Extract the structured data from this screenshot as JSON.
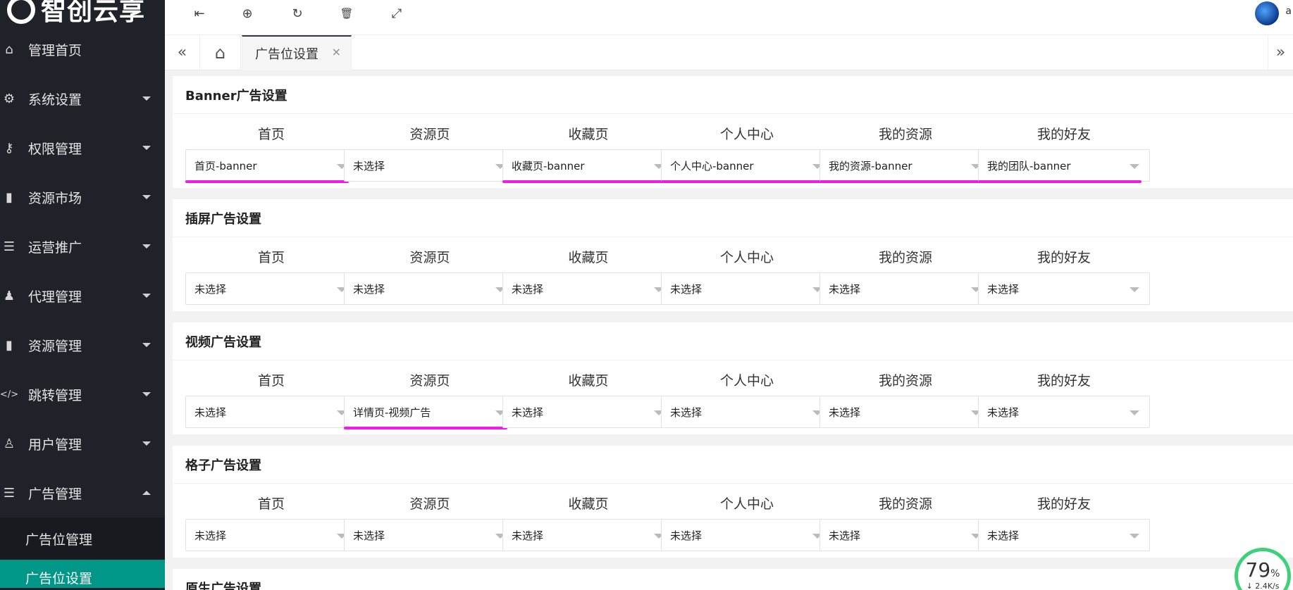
{
  "logo": {
    "text": "智创云享"
  },
  "sidebar": {
    "items": [
      {
        "label": "管理首页",
        "icon": "home-icon",
        "glyph": "⌂",
        "expandable": false
      },
      {
        "label": "系统设置",
        "icon": "gear-icon",
        "glyph": "⚙",
        "expandable": true
      },
      {
        "label": "权限管理",
        "icon": "user-lock-icon",
        "glyph": "⚷",
        "expandable": true
      },
      {
        "label": "资源市场",
        "icon": "book-icon",
        "glyph": "▮",
        "expandable": true
      },
      {
        "label": "运营推广",
        "icon": "list-icon",
        "glyph": "☰",
        "expandable": true
      },
      {
        "label": "代理管理",
        "icon": "users-icon",
        "glyph": "♟",
        "expandable": true
      },
      {
        "label": "资源管理",
        "icon": "book-icon",
        "glyph": "▮",
        "expandable": true
      },
      {
        "label": "跳转管理",
        "icon": "code-icon",
        "glyph": "</>",
        "expandable": true
      },
      {
        "label": "用户管理",
        "icon": "user-icon",
        "glyph": "♙",
        "expandable": true
      },
      {
        "label": "广告管理",
        "icon": "list-icon",
        "glyph": "☰",
        "expandable": true,
        "expanded": true
      }
    ],
    "sub_items": [
      {
        "label": "广告位管理",
        "active": false
      },
      {
        "label": "广告位设置",
        "active": true
      }
    ]
  },
  "toolbar": {
    "icons": [
      "collapse-menu-icon",
      "globe-icon",
      "refresh-icon",
      "trash-icon",
      "fullscreen-icon"
    ],
    "glyphs": [
      "⇤",
      "⊕",
      "↻",
      "🗑",
      "⤢"
    ],
    "user_initial": "a"
  },
  "tabs": {
    "prev": "«",
    "home": "⌂",
    "active_tab": "广告位设置",
    "close": "×",
    "next": "»"
  },
  "columns": [
    "首页",
    "资源页",
    "收藏页",
    "个人中心",
    "我的资源",
    "我的好友"
  ],
  "sections": [
    {
      "title": "Banner广告设置",
      "values": [
        "首页-banner",
        "未选择",
        "收藏页-banner",
        "个人中心-banner",
        "我的资源-banner",
        "我的团队-banner"
      ]
    },
    {
      "title": "插屏广告设置",
      "values": [
        "未选择",
        "未选择",
        "未选择",
        "未选择",
        "未选择",
        "未选择"
      ]
    },
    {
      "title": "视频广告设置",
      "values": [
        "未选择",
        "详情页-视频广告",
        "未选择",
        "未选择",
        "未选择",
        "未选择"
      ]
    },
    {
      "title": "格子广告设置",
      "values": [
        "未选择",
        "未选择",
        "未选择",
        "未选择",
        "未选择",
        "未选择"
      ]
    },
    {
      "title": "原生广告设置",
      "values": []
    }
  ],
  "highlight_color": "#ef1ce5",
  "accent_color": "#009688",
  "net_widget": {
    "percent": "79",
    "unit": "%",
    "speed": "↓ 2.4K/s"
  }
}
